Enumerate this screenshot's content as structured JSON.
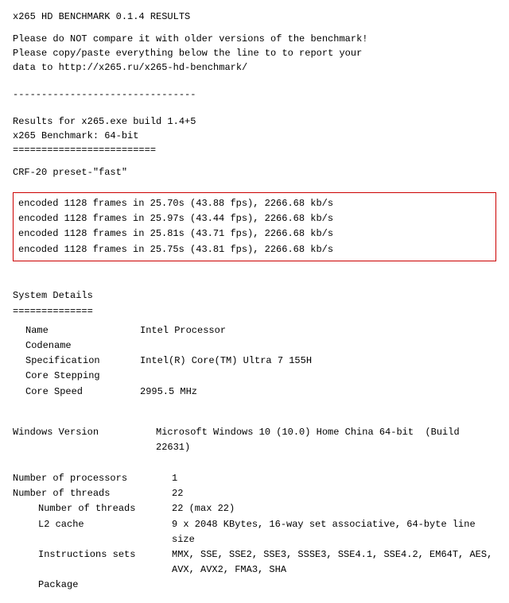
{
  "header": {
    "title": "x265 HD BENCHMARK 0.1.4 RESULTS"
  },
  "intro": {
    "line1": "Please do NOT compare it with older versions of the benchmark!",
    "line2": "Please copy/paste everything below the line to to report your",
    "line3": "data to http://x265.ru/x265-hd-benchmark/"
  },
  "divider": "--------------------------------",
  "build_info": {
    "line1": "Results for x265.exe build 1.4+5",
    "line2": "x265 Benchmark: 64-bit",
    "line3": "========================="
  },
  "crf_label": "CRF-20 preset-\"fast\"",
  "encoded_results": [
    "encoded 1128 frames in 25.70s (43.88 fps), 2266.68 kb/s",
    "encoded 1128 frames in 25.97s (43.44 fps), 2266.68 kb/s",
    "encoded 1128 frames in 25.81s (43.71 fps), 2266.68 kb/s",
    "encoded 1128 frames in 25.75s (43.81 fps), 2266.68 kb/s"
  ],
  "system_details": {
    "title": "System Details",
    "divider": "==============",
    "rows": [
      {
        "label": "Name",
        "value": "Intel Processor"
      },
      {
        "label": "Codename",
        "value": ""
      },
      {
        "label": "Specification",
        "value": "Intel(R) Core(TM) Ultra 7 155H"
      },
      {
        "label": "Core Stepping",
        "value": ""
      },
      {
        "label": "Core Speed",
        "value": "2995.5 MHz"
      }
    ]
  },
  "windows_section": {
    "label": "Windows Version",
    "value": "Microsoft Windows 10 (10.0) Home China 64-bit  (Build 22631)"
  },
  "processors_section": {
    "rows": [
      {
        "label": "Number of processors",
        "value": "1"
      },
      {
        "label": "Number of threads",
        "value": "22"
      },
      {
        "sublabel": "Number of threads",
        "subvalue": "22 (max 22)"
      },
      {
        "sublabel": "L2 cache",
        "subvalue": "9 x 2048 KBytes, 16-way set associative, 64-byte line size"
      },
      {
        "sublabel": "Instructions sets",
        "subvalue": "MMX, SSE, SSE2, SSE3, SSSE3, SSE4.1, SSE4.2, EM64T, AES, AVX, AVX2, FMA3, SHA"
      },
      {
        "sublabel": "Package",
        "subvalue": ""
      }
    ]
  }
}
